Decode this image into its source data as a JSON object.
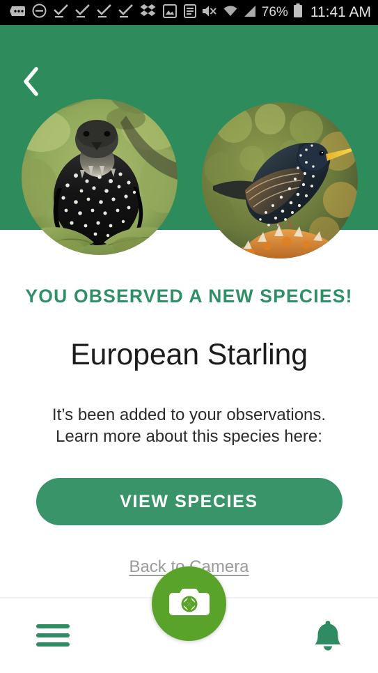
{
  "status_bar": {
    "icons": [
      "message-dots-icon",
      "do-not-disturb-icon",
      "task-check-icon",
      "task-check-icon",
      "task-check-icon",
      "task-check-icon",
      "dropbox-icon",
      "photo-icon",
      "document-icon"
    ],
    "mute_icon": "volume-muted-icon",
    "wifi_icon": "wifi-icon",
    "signal_icon": "cellular-signal-icon",
    "battery_percent": "76%",
    "battery_icon": "battery-icon",
    "clock": "11:41 AM"
  },
  "header": {
    "background_color": "#2e8b5c",
    "back_icon": "chevron-left-icon",
    "photos": [
      {
        "name": "starling-front-photo",
        "alt": "European Starling facing camera on green leaves"
      },
      {
        "name": "starling-profile-photo",
        "alt": "European Starling in profile with yellow beak on lichen"
      }
    ]
  },
  "main": {
    "eyebrow": "YOU OBSERVED A NEW SPECIES!",
    "eyebrow_color": "#2f8f66",
    "species_name": "European Starling",
    "blurb_line1": "It’s been added to your observations.",
    "blurb_line2": "Learn more about this species here:",
    "cta_label": "VIEW SPECIES",
    "cta_color": "#3a9469",
    "secondary_link": "Back to Camera"
  },
  "bottom_nav": {
    "menu_icon": "hamburger-menu-icon",
    "camera_icon": "camera-icon",
    "notifications_icon": "bell-icon",
    "fab_color": "#5aa32b",
    "icon_color": "#2f8b62"
  }
}
